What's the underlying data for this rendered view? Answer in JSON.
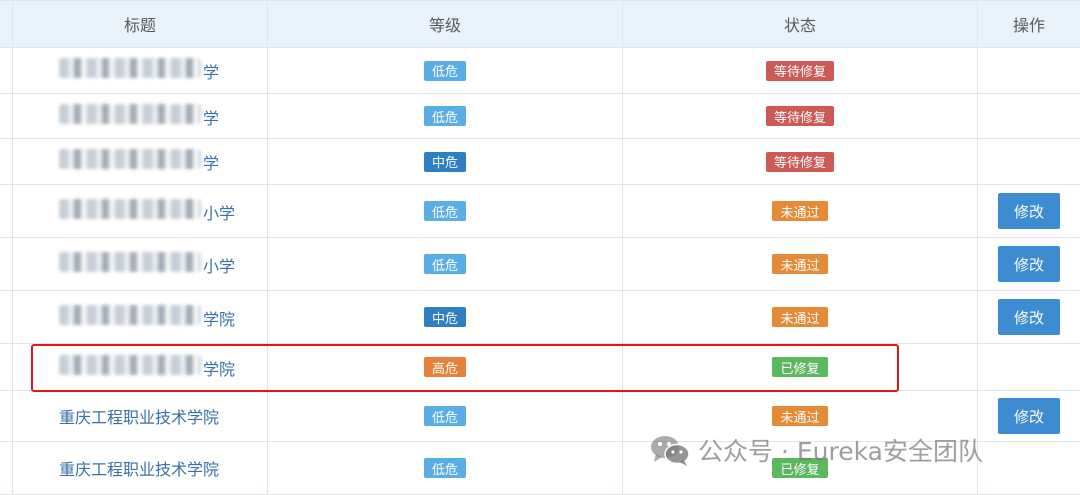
{
  "table": {
    "headers": [
      "标题",
      "等级",
      "状态",
      "操作"
    ],
    "rows": [
      {
        "title": "",
        "title_suffix": "学",
        "level": "低危",
        "level_color": "#5aaee6",
        "status": "等待修复",
        "status_color": "#cd5a56",
        "action": ""
      },
      {
        "title": "",
        "title_suffix": "学",
        "level": "低危",
        "level_color": "#5aaee6",
        "status": "等待修复",
        "status_color": "#cd5a56",
        "action": ""
      },
      {
        "title": "",
        "title_suffix": "学",
        "level": "中危",
        "level_color": "#2f7fc4",
        "status": "等待修复",
        "status_color": "#cd5a56",
        "action": ""
      },
      {
        "title": "",
        "title_suffix": "小学",
        "level": "低危",
        "level_color": "#5aaee6",
        "status": "未通过",
        "status_color": "#e58a36",
        "action": "修改"
      },
      {
        "title": "",
        "title_suffix": "小学",
        "level": "低危",
        "level_color": "#5aaee6",
        "status": "未通过",
        "status_color": "#e58a36",
        "action": "修改"
      },
      {
        "title": "",
        "title_suffix": "学院",
        "level": "中危",
        "level_color": "#2f7fc4",
        "status": "未通过",
        "status_color": "#e58a36",
        "action": "修改"
      },
      {
        "title": "",
        "title_suffix": "学院",
        "level": "高危",
        "level_color": "#e6813b",
        "status": "已修复",
        "status_color": "#5cb85c",
        "action": ""
      },
      {
        "title": "重庆工程职业技术学院",
        "title_suffix": "",
        "level": "低危",
        "level_color": "#5aaee6",
        "status": "未通过",
        "status_color": "#e58a36",
        "action": "修改"
      },
      {
        "title": "重庆工程职业技术学院",
        "title_suffix": "",
        "level": "低危",
        "level_color": "#5aaee6",
        "status": "已修复",
        "status_color": "#5cb85c",
        "action": ""
      }
    ]
  },
  "watermark": {
    "text": "公众号 · Eureka安全团队",
    "icon": "wechat-icon"
  },
  "highlight_color": "#e3141b"
}
